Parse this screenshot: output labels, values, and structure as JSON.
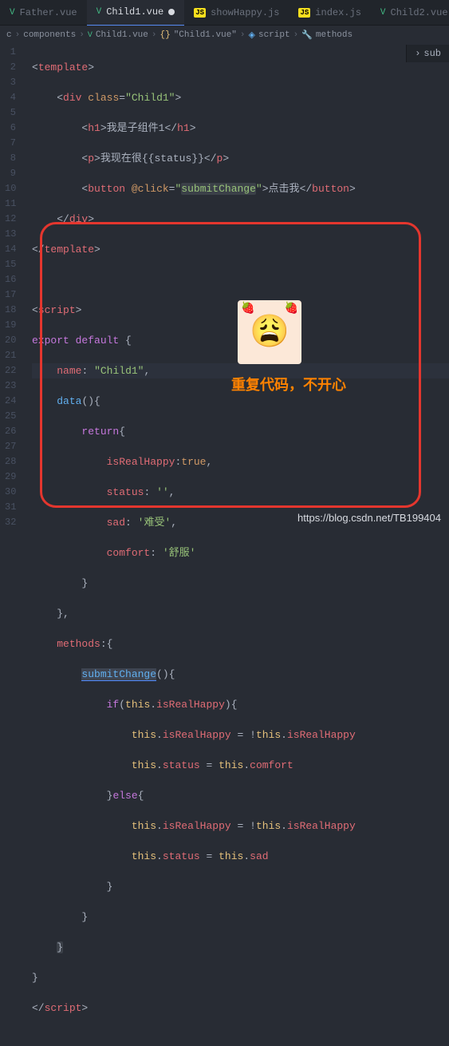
{
  "tabs": {
    "t0": "Father.vue",
    "t1": "Child1.vue",
    "t2": "showHappy.js",
    "t3": "index.js",
    "t4": "Child2.vue"
  },
  "breadcrumb": {
    "p0": "c",
    "p1": "components",
    "p2": "Child1.vue",
    "p3": "\"Child1.vue\"",
    "p4": "script",
    "p5": "methods"
  },
  "minimap": {
    "label": "sub"
  },
  "lines": {
    "l1_tag": "template",
    "l2_tag": "div",
    "l2_attr": "class",
    "l2_val": "\"Child1\"",
    "l3_tag": "h1",
    "l3_text": "我是子组件1",
    "l4_tag": "p",
    "l4_text1": "我现在很",
    "l4_expr": "{{status}}",
    "l5_tag": "button",
    "l5_attr": "@click",
    "l5_val": "\"submitChange\"",
    "l5_method": "submitChange",
    "l5_text": "点击我",
    "l9_tag": "script",
    "l10_export": "export",
    "l10_default": "default",
    "l11_name": "name",
    "l11_val": "\"Child1\"",
    "l12_data": "data",
    "l13_return": "return",
    "l14_k": "isRealHappy",
    "l14_v": "true",
    "l15_k": "status",
    "l15_v": "''",
    "l16_k": "sad",
    "l16_v": "'难受'",
    "l17_k": "comfort",
    "l17_v": "'舒服'",
    "l20_methods": "methods",
    "l21_submit": "submitChange",
    "l22_if": "if",
    "l22_this": "this",
    "l22_prop": "isRealHappy",
    "l23_this": "this",
    "l23_prop1": "isRealHappy",
    "l23_prop2": "isRealHappy",
    "l24_this": "this",
    "l24_prop1": "status",
    "l24_prop2": "comfort",
    "l25_else": "else",
    "l26_this": "this",
    "l26_prop1": "isRealHappy",
    "l26_prop2": "isRealHappy",
    "l27_this": "this",
    "l27_prop1": "status",
    "l27_prop2": "sad",
    "l32_tag": "script"
  },
  "annotation": {
    "text": "重复代码，不开心"
  },
  "watermark": {
    "text": "https://blog.csdn.net/TB199404"
  }
}
